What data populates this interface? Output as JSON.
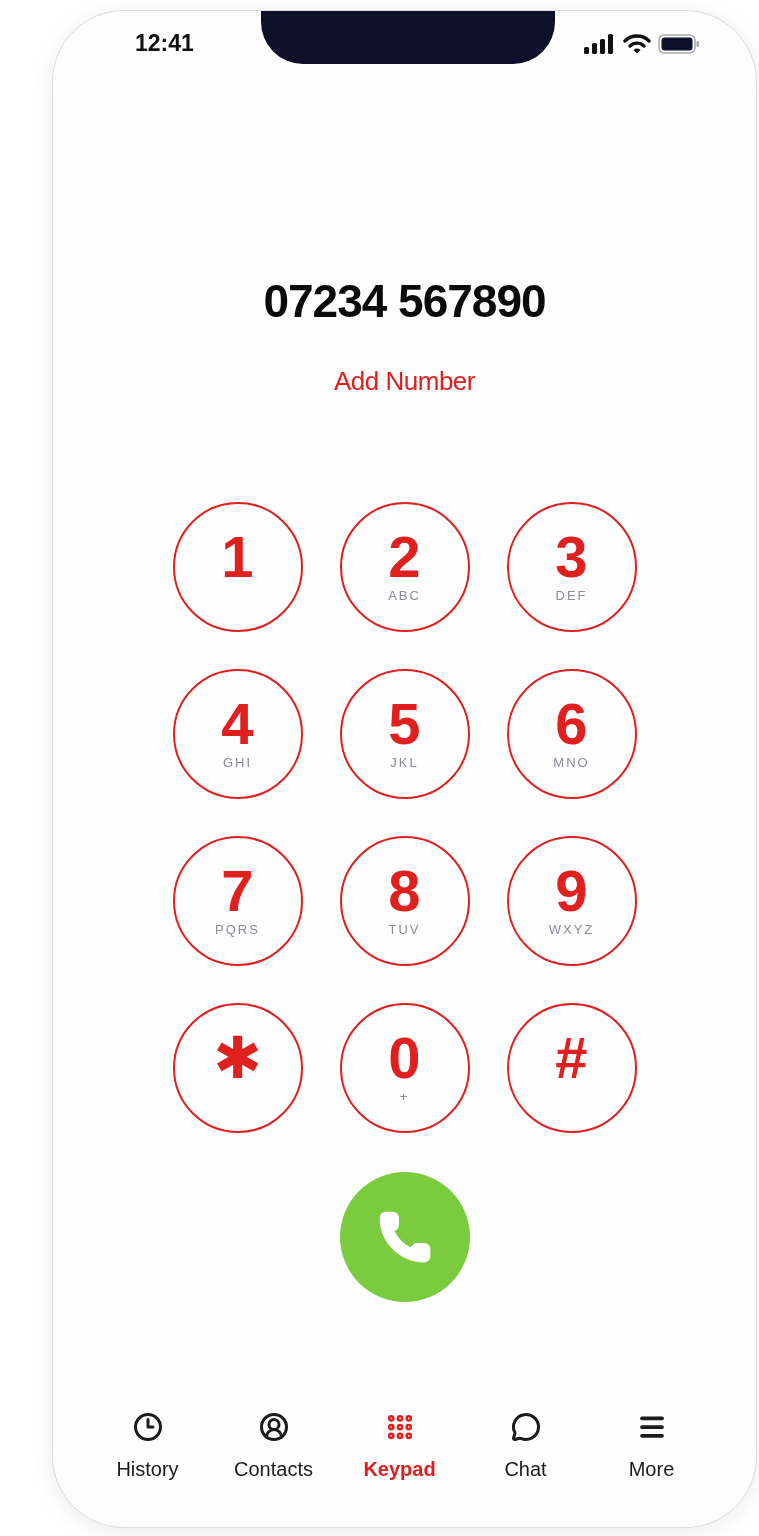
{
  "status_bar": {
    "time": "12:41"
  },
  "dialed_number": "07234 567890",
  "add_number": "Add Number",
  "keys": [
    {
      "digit": "1"
    },
    {
      "digit": "2",
      "letters": "ABC"
    },
    {
      "digit": "3",
      "letters": "DEF"
    },
    {
      "digit": "4",
      "letters": "GHI"
    },
    {
      "digit": "5",
      "letters": "JKL"
    },
    {
      "digit": "6",
      "letters": "MNO"
    },
    {
      "digit": "7",
      "letters": "PQRS"
    },
    {
      "digit": "8",
      "letters": "TUV"
    },
    {
      "digit": "9",
      "letters": "WXYZ"
    },
    {
      "digit": "✱"
    },
    {
      "digit": "0",
      "letters": "+"
    },
    {
      "digit": "#"
    }
  ],
  "tabs": [
    {
      "kind": "history",
      "label": "History",
      "selected": false
    },
    {
      "kind": "contacts",
      "label": "Contacts",
      "selected": false
    },
    {
      "kind": "keypad",
      "label": "Keypad",
      "selected": true
    },
    {
      "kind": "chat",
      "label": "Chat",
      "selected": false
    },
    {
      "kind": "more",
      "label": "More",
      "selected": false
    }
  ]
}
